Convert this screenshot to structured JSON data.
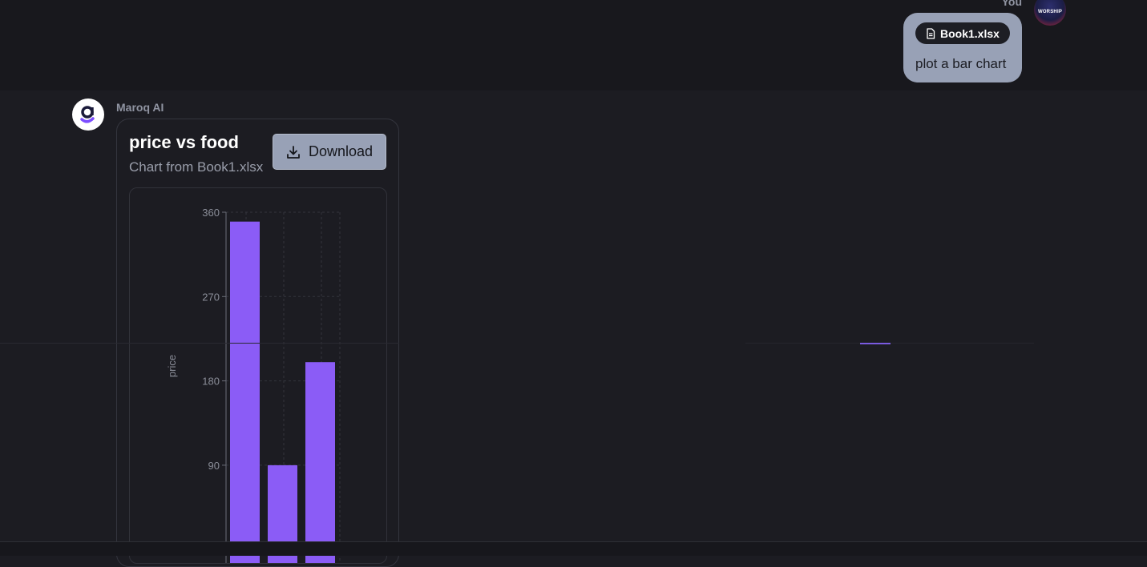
{
  "user": {
    "name": "You",
    "avatar_text": "WORSHIP",
    "attachment": "Book1.xlsx",
    "message": "plot a bar chart"
  },
  "assistant": {
    "name": "Maroq AI",
    "chart_card": {
      "title": "price vs food",
      "subtitle": "Chart from Book1.xlsx",
      "download_label": "Download"
    }
  },
  "chart_data": {
    "type": "bar",
    "title": "price vs food",
    "xlabel": "",
    "ylabel": "price",
    "ylim": [
      0,
      360
    ],
    "yticks": [
      90,
      180,
      270,
      360
    ],
    "grid": true,
    "values": [
      350,
      90,
      200
    ],
    "color": "#8b5cf6"
  }
}
